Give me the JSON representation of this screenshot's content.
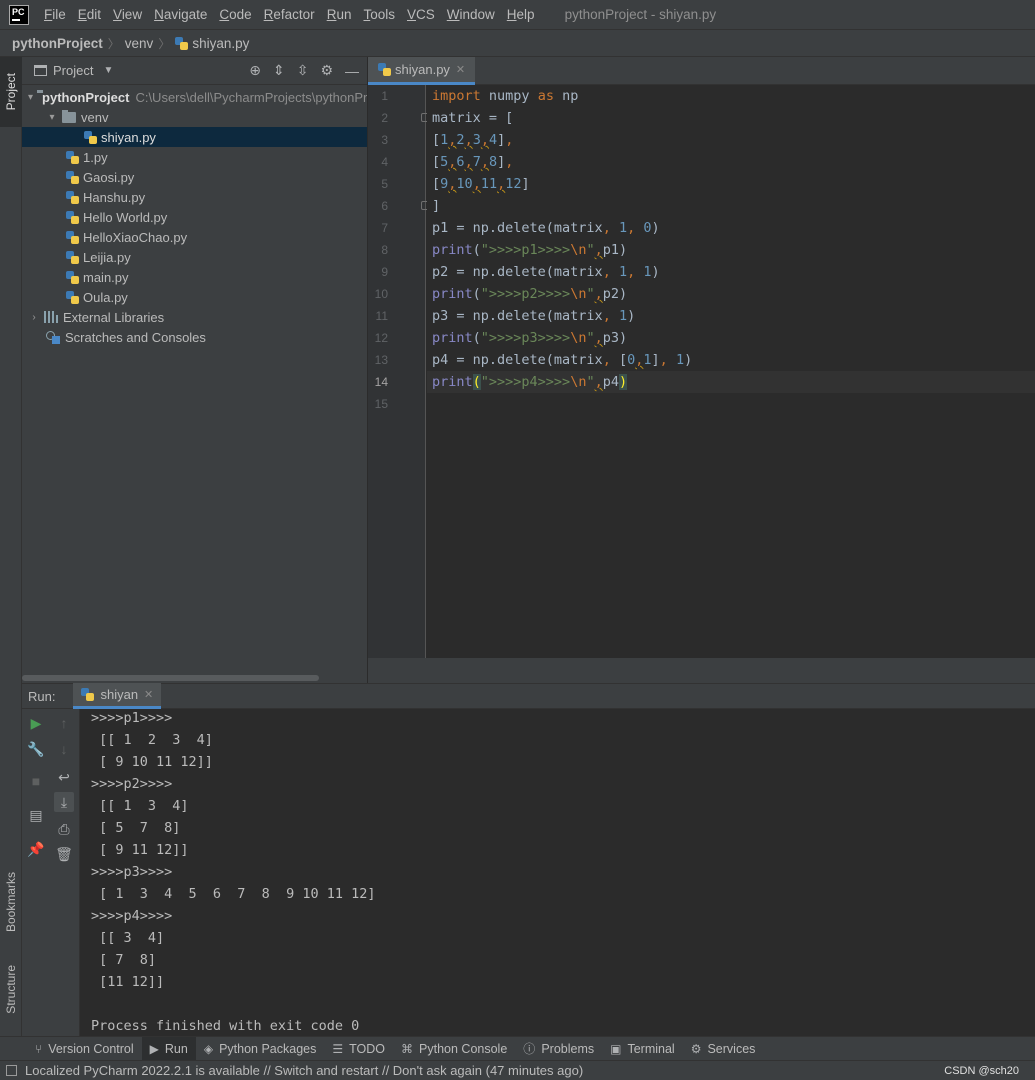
{
  "menubar": {
    "logo": "PC",
    "items": [
      {
        "label": "File",
        "u": "F",
        "rest": "ile"
      },
      {
        "label": "Edit",
        "u": "E",
        "rest": "dit"
      },
      {
        "label": "View",
        "u": "V",
        "rest": "iew"
      },
      {
        "label": "Navigate",
        "u": "N",
        "rest": "avigate"
      },
      {
        "label": "Code",
        "u": "C",
        "rest": "ode"
      },
      {
        "label": "Refactor",
        "u": "R",
        "rest": "efactor"
      },
      {
        "label": "Run",
        "u": "R",
        "rest": "un"
      },
      {
        "label": "Tools",
        "u": "T",
        "rest": "ools"
      },
      {
        "label": "VCS",
        "u": "V",
        "rest": "CS"
      },
      {
        "label": "Window",
        "u": "W",
        "rest": "indow"
      },
      {
        "label": "Help",
        "u": "H",
        "rest": "elp"
      }
    ],
    "window_title": "pythonProject - shiyan.py"
  },
  "breadcrumb": [
    "pythonProject",
    "venv",
    "shiyan.py"
  ],
  "left_strip": {
    "project": "Project",
    "bookmarks": "Bookmarks",
    "structure": "Structure"
  },
  "project_panel": {
    "title": "Project",
    "root": {
      "label": "pythonProject",
      "path": "C:\\Users\\dell\\PycharmProjects\\pythonProject"
    },
    "venv": "venv",
    "selected_file": "shiyan.py",
    "files": [
      "1.py",
      "Gaosi.py",
      "Hanshu.py",
      "Hello World.py",
      "HelloXiaoChao.py",
      "Leijia.py",
      "main.py",
      "Oula.py"
    ],
    "external_libraries": "External Libraries",
    "scratches": "Scratches and Consoles"
  },
  "editor": {
    "tab": "shiyan.py",
    "line_numbers": [
      "1",
      "2",
      "3",
      "4",
      "5",
      "6",
      "7",
      "8",
      "9",
      "10",
      "11",
      "12",
      "13",
      "14",
      "15"
    ],
    "current_line": "14"
  },
  "run_panel": {
    "title": "Run:",
    "tab": "shiyan",
    "output": [
      ">>>>p1>>>>",
      " [[ 1  2  3  4]",
      " [ 9 10 11 12]]",
      ">>>>p2>>>>",
      " [[ 1  3  4]",
      " [ 5  7  8]",
      " [ 9 11 12]]",
      ">>>>p3>>>>",
      " [ 1  3  4  5  6  7  8  9 10 11 12]",
      ">>>>p4>>>>",
      " [[ 3  4]",
      " [ 7  8]",
      " [11 12]]",
      "",
      "Process finished with exit code 0"
    ]
  },
  "tool_windows": [
    "Version Control",
    "Run",
    "Python Packages",
    "TODO",
    "Python Console",
    "Problems",
    "Terminal",
    "Services"
  ],
  "status_bar": {
    "message": "Localized PyCharm 2022.2.1 is available // Switch and restart // Don't ask again (47 minutes ago)",
    "watermark": "CSDN @sch20"
  },
  "colors": {
    "accent": "#4a88c7",
    "keyword": "#cc7832",
    "number": "#6897bb",
    "string": "#6a8759",
    "builtin": "#8888c6"
  }
}
